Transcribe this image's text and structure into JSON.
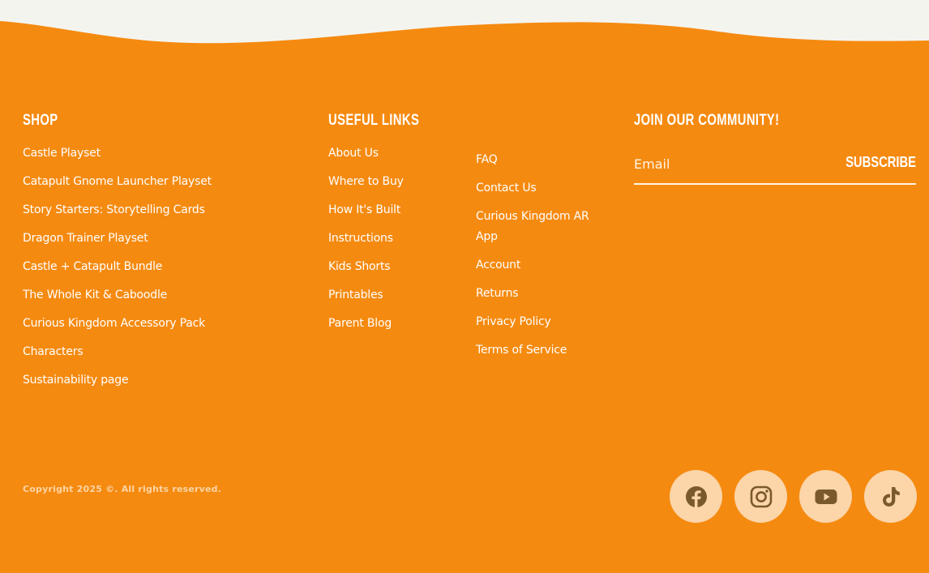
{
  "shop": {
    "heading": "SHOP",
    "links": [
      "Castle Playset",
      "Catapult Gnome Launcher Playset",
      "Story Starters: Storytelling Cards",
      "Dragon Trainer Playset",
      "Castle + Catapult Bundle",
      "The Whole Kit & Caboodle",
      "Curious Kingdom Accessory Pack",
      "Characters",
      "Sustainability page"
    ]
  },
  "useful": {
    "heading": "USEFUL LINKS",
    "links": [
      "About Us",
      "Where to Buy",
      "How It's Built",
      "Instructions",
      "Kids Shorts",
      "Printables",
      "Parent Blog"
    ],
    "links2": [
      "FAQ",
      "Contact Us",
      "Curious Kingdom AR App",
      "Account",
      "Returns",
      "Privacy Policy",
      "Terms of Service"
    ]
  },
  "community": {
    "heading": "JOIN OUR COMMUNITY!",
    "email_placeholder": "Email",
    "subscribe_label": "SUBSCRIBE"
  },
  "footer": {
    "copyright": "Copyright 2025 ©. All rights reserved."
  },
  "social": [
    "facebook-icon",
    "instagram-icon",
    "youtube-icon",
    "tiktok-icon"
  ],
  "colors": {
    "background": "#f58a10",
    "wave": "#f4f4ef",
    "social_bg": "#fcd5a9",
    "icon": "#7a5a2c"
  }
}
